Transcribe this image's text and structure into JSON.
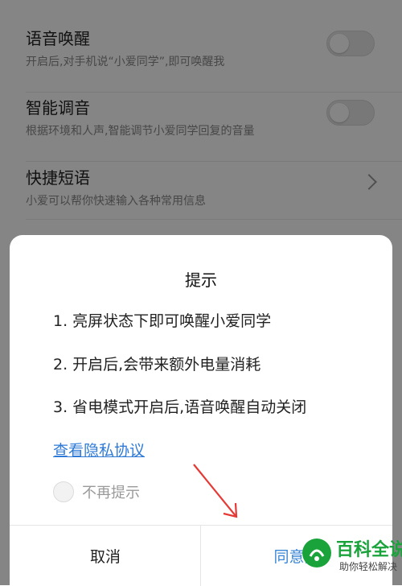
{
  "settings": {
    "items": [
      {
        "title": "语音唤醒",
        "subtitle": "开启后,对手机说“小爱同学”,即可唤醒我",
        "control": "toggle",
        "on": false
      },
      {
        "title": "智能调音",
        "subtitle": "根据环境和人声,智能调节小爱同学回复的音量",
        "control": "toggle",
        "on": false
      },
      {
        "title": "快捷短语",
        "subtitle": "小爱可以帮你快速输入各种常用信息",
        "control": "chevron"
      }
    ]
  },
  "dialog": {
    "title": "提示",
    "items": [
      "1. 亮屏状态下即可唤醒小爱同学",
      "2. 开启后,会带来额外电量消耗",
      "3. 省电模式开启后,语音唤醒自动关闭"
    ],
    "privacy_link": "查看隐私协议",
    "checkbox_label": "不再提示",
    "cancel_label": "取消",
    "agree_label": "同意并"
  },
  "watermark": {
    "brand": "百科全说",
    "tagline": "助你轻松解决",
    "color": "#1aa33b"
  }
}
